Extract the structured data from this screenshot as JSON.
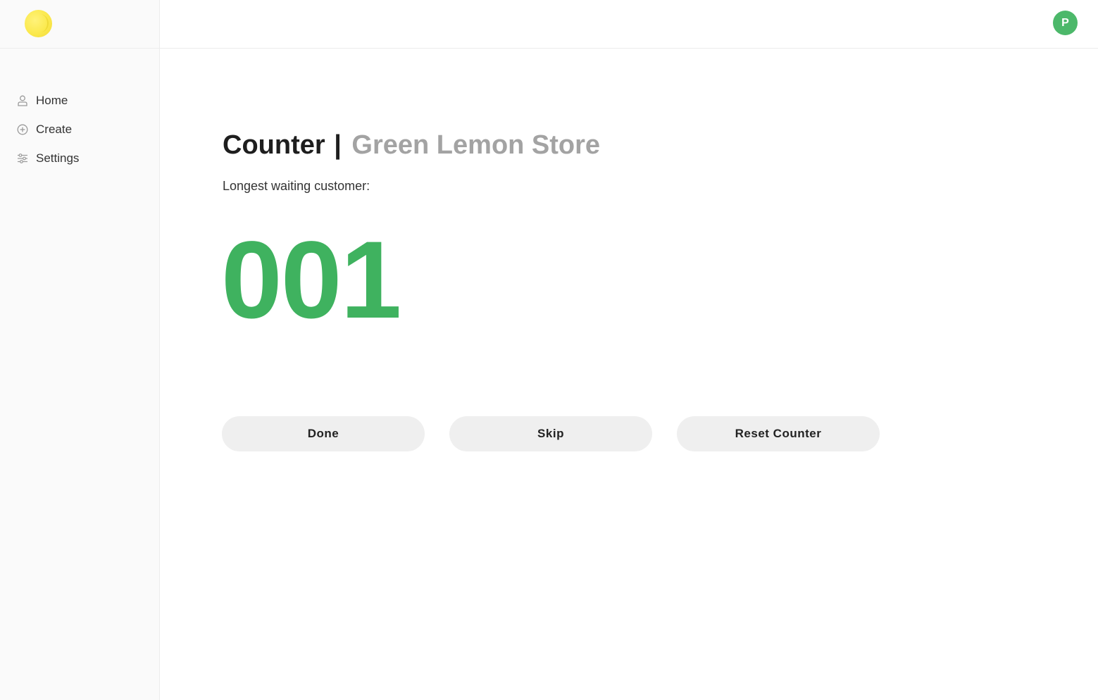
{
  "sidebar": {
    "logo_icon": "lemon-logo-icon",
    "items": [
      {
        "label": "Home",
        "icon": "user-icon"
      },
      {
        "label": "Create",
        "icon": "plus-circle-icon"
      },
      {
        "label": "Settings",
        "icon": "sliders-icon"
      }
    ]
  },
  "header": {
    "avatar_initial": "P",
    "avatar_color": "#4cb86a"
  },
  "main": {
    "title": "Counter",
    "separator": "|",
    "store_name": "Green Lemon Store",
    "subtitle": "Longest waiting customer:",
    "counter_value": "001",
    "counter_color": "#3fb25f"
  },
  "actions": {
    "done_label": "Done",
    "skip_label": "Skip",
    "reset_label": "Reset Counter"
  }
}
